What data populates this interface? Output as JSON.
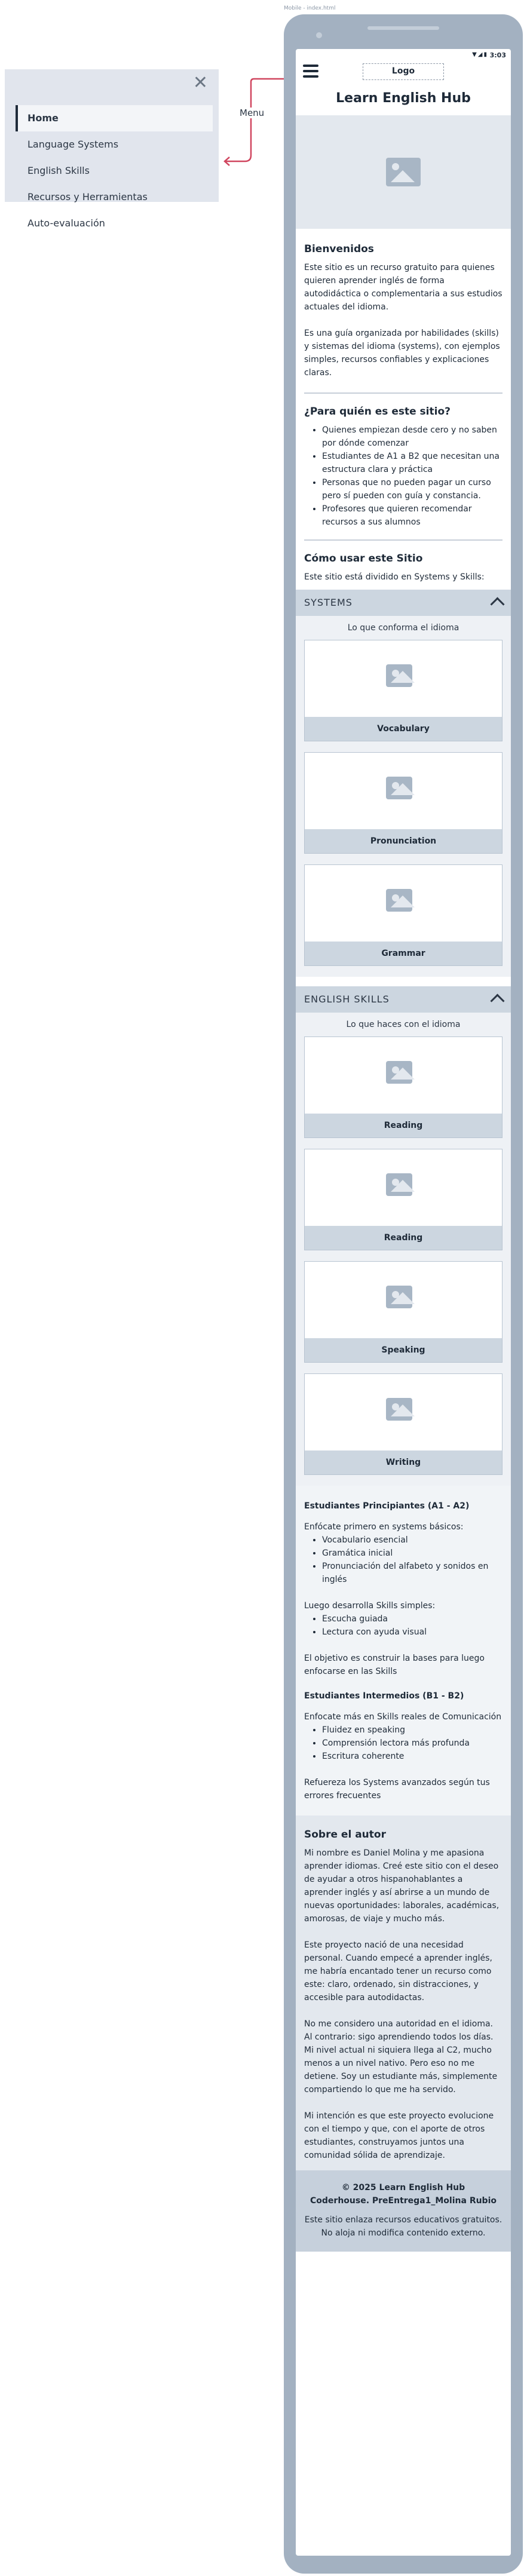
{
  "canvas": {
    "caption": "Mobile - index.html"
  },
  "side_menu": {
    "annotation": "Menu",
    "items": [
      "Home",
      "Language Systems",
      "English Skills",
      "Recursos y Herramientas",
      "Auto-evaluación"
    ]
  },
  "status_bar": {
    "time": "3:03"
  },
  "header": {
    "logo": "Logo"
  },
  "site_title": "Learn English Hub",
  "welcome": {
    "heading": "Bienvenidos",
    "p1": "Este sitio es un recurso gratuito para quienes quieren aprender inglés de forma autodidáctica o complementaria a sus estudios actuales del idioma.",
    "p2": "Es una guía organizada por habilidades (skills) y sistemas del idioma (systems), con ejemplos simples, recursos confiables y explicaciones claras."
  },
  "audience": {
    "heading": "¿Para quién es este sitio?",
    "items": [
      "Quienes empiezan desde cero y no saben por dónde comenzar",
      "Estudiantes de A1 a B2 que necesitan una estructura clara y práctica",
      "Personas que no pueden pagar un curso pero sí pueden con guía y constancia.",
      "Profesores que quieren recomendar recursos a sus alumnos"
    ]
  },
  "howto": {
    "heading": "Cómo usar este Sitio",
    "text": "Este sitio está dividido en Systems y Skills:"
  },
  "systems": {
    "title": "SYSTEMS",
    "subtitle": "Lo que conforma el idioma",
    "cards": [
      "Vocabulary",
      "Pronunciation",
      "Grammar"
    ]
  },
  "skills": {
    "title": "ENGLISH SKILLS",
    "subtitle": "Lo que haces con el idioma",
    "cards": [
      "Reading",
      "Reading",
      "Speaking",
      "Writing"
    ]
  },
  "levels": {
    "beginner_heading": "Estudiantes Principiantes (A1 - A2)",
    "beginner_intro": "Enfócate primero en systems básicos:",
    "beginner_items": [
      "Vocabulario esencial",
      "Gramática inicial",
      "Pronunciación del alfabeto y sonidos en inglés"
    ],
    "beginner_skills_intro": "Luego desarrolla Skills simples:",
    "beginner_skills_items": [
      "Escucha guiada",
      "Lectura con ayuda visual"
    ],
    "beginner_goal": "El objetivo es construir la bases para luego enfocarse en las Skills",
    "intermediate_heading": "Estudiantes Intermedios (B1 - B2)",
    "intermediate_intro": "Enfocate más en Skills reales de Comunicación",
    "intermediate_items": [
      "Fluidez en speaking",
      "Comprensión lectora más profunda",
      "Escritura coherente"
    ],
    "intermediate_note": "Refuereza los Systems avanzados según tus errores frecuentes"
  },
  "about": {
    "heading": "Sobre el autor",
    "p1": "Mi nombre es Daniel Molina y me apasiona aprender idiomas. Creé este sitio con el deseo de ayudar a otros hispanohablantes a aprender inglés y así abrirse a un mundo de nuevas oportunidades: laborales, académicas, amorosas, de viaje y mucho más.",
    "p2": "Este proyecto nació de una necesidad personal. Cuando empecé a aprender inglés, me habría encantado tener un recurso como este: claro, ordenado, sin distracciones, y accesible para autodidactas.",
    "p3": "No me considero una autoridad en el idioma. Al contrario: sigo aprendiendo todos los días. Mi nivel actual ni siquiera llega al C2, mucho menos a un nivel nativo. Pero eso no me detiene. Soy un estudiante más, simplemente compartiendo lo que me ha servido.",
    "p4": "Mi intención es que este proyecto evolucione con el tiempo y que, con el aporte de otros estudiantes, construyamos juntos una comunidad sólida de aprendizaje."
  },
  "footer": {
    "line1": "© 2025 Learn English Hub",
    "line2": "Coderhouse. PreEntrega1_Molina Rubio",
    "note": "Este sitio enlaza recursos educativos gratuitos. No aloja ni modifica contenido externo."
  },
  "colors": {
    "menu_arrow": "#d0455e",
    "phone_frame": "#a3b1c1",
    "accent_bar": "#ccd6e0"
  }
}
